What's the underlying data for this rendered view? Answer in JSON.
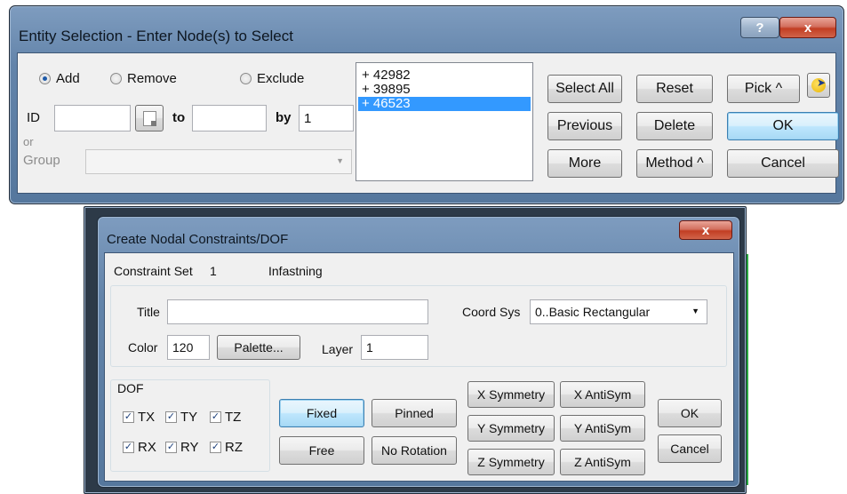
{
  "entity_dialog": {
    "title": "Entity Selection - Enter Node(s) to Select",
    "help_label": "?",
    "close_label": "x",
    "mode_options": [
      {
        "label": "Add",
        "selected": true
      },
      {
        "label": "Remove",
        "selected": false
      },
      {
        "label": "Exclude",
        "selected": false
      }
    ],
    "id_label": "ID",
    "id_value": "",
    "to_label": "to",
    "to_value": "",
    "by_label": "by",
    "by_value": "1",
    "or_label": "or",
    "group_label": "Group",
    "group_value": "",
    "list_items": [
      {
        "text": "+  42982",
        "selected": false
      },
      {
        "text": "+  39895",
        "selected": false
      },
      {
        "text": "+  46523",
        "selected": true
      }
    ],
    "buttons": {
      "select_all": "Select All",
      "reset": "Reset",
      "pick": "Pick ^",
      "previous": "Previous",
      "delete": "Delete",
      "ok": "OK",
      "more": "More",
      "method": "Method ^",
      "cancel": "Cancel"
    }
  },
  "constraint_dialog": {
    "title": "Create Nodal Constraints/DOF",
    "close_label": "x",
    "constraint_set_label": "Constraint Set",
    "constraint_set_value": "1",
    "constraint_set_name": "Infastning",
    "title_label": "Title",
    "title_value": "",
    "coord_sys_label": "Coord Sys",
    "coord_sys_value": "0..Basic Rectangular",
    "color_label": "Color",
    "color_value": "120",
    "palette_button": "Palette...",
    "layer_label": "Layer",
    "layer_value": "1",
    "dof_label": "DOF",
    "dof_checks": [
      {
        "label": "TX",
        "checked": true
      },
      {
        "label": "TY",
        "checked": true
      },
      {
        "label": "TZ",
        "checked": true
      },
      {
        "label": "RX",
        "checked": true
      },
      {
        "label": "RY",
        "checked": true
      },
      {
        "label": "RZ",
        "checked": true
      }
    ],
    "buttons": {
      "fixed": "Fixed",
      "pinned": "Pinned",
      "free": "Free",
      "no_rotation": "No Rotation",
      "x_symmetry": "X Symmetry",
      "x_antisym": "X AntiSym",
      "y_symmetry": "Y Symmetry",
      "y_antisym": "Y AntiSym",
      "z_symmetry": "Z Symmetry",
      "z_antisym": "Z AntiSym",
      "ok": "OK",
      "cancel": "Cancel"
    }
  }
}
